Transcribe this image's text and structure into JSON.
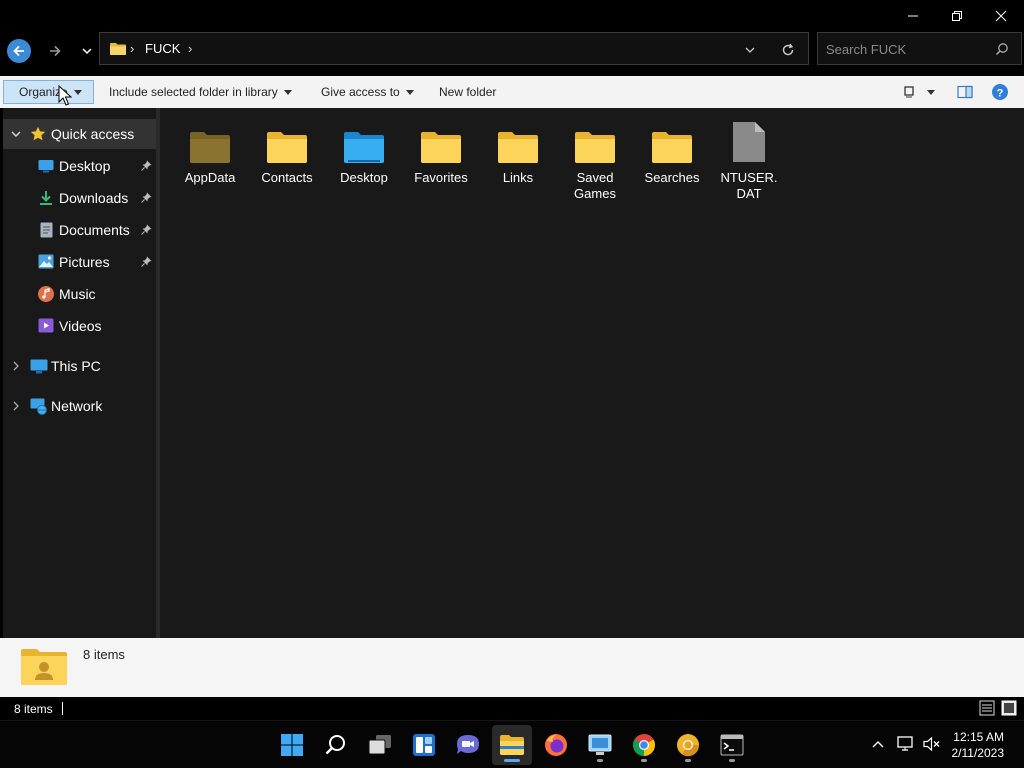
{
  "window": {
    "controls": {
      "minimize_icon": "minimize-icon",
      "restore_icon": "restore-icon",
      "close_icon": "close-icon"
    }
  },
  "address": {
    "crumb": "FUCK",
    "separator": "›",
    "search_placeholder": "Search FUCK"
  },
  "toolbar": {
    "organize": "Organize",
    "include_library": "Include selected folder in library",
    "give_access": "Give access to",
    "new_folder": "New folder"
  },
  "nav": {
    "quick_access": "Quick access",
    "items": [
      {
        "label": "Desktop",
        "pinned": true,
        "color": "#3aa0e8"
      },
      {
        "label": "Downloads",
        "pinned": true,
        "color": "#3cb878"
      },
      {
        "label": "Documents",
        "pinned": true,
        "color": "#a9b4c2"
      },
      {
        "label": "Pictures",
        "pinned": true,
        "color": "#4aa0e0"
      },
      {
        "label": "Music",
        "pinned": false,
        "color": "#e0704a"
      },
      {
        "label": "Videos",
        "pinned": false,
        "color": "#8a5ad8"
      }
    ],
    "this_pc": "This PC",
    "network": "Network"
  },
  "files": [
    {
      "name": "AppData",
      "type": "folder-hidden"
    },
    {
      "name": "Contacts",
      "type": "folder"
    },
    {
      "name": "Desktop",
      "type": "folder-desktop"
    },
    {
      "name": "Favorites",
      "type": "folder"
    },
    {
      "name": "Links",
      "type": "folder"
    },
    {
      "name": "Saved Games",
      "type": "folder"
    },
    {
      "name": "Searches",
      "type": "folder"
    },
    {
      "name": "NTUSER. DAT",
      "type": "file"
    }
  ],
  "details": {
    "count": "8 items"
  },
  "status": {
    "count": "8 items"
  },
  "clock": {
    "time": "12:15 AM",
    "date": "2/11/2023"
  },
  "colors": {
    "accent": "#3b8ad8",
    "folder": "#f5c542",
    "selection": "#cde4f7"
  }
}
